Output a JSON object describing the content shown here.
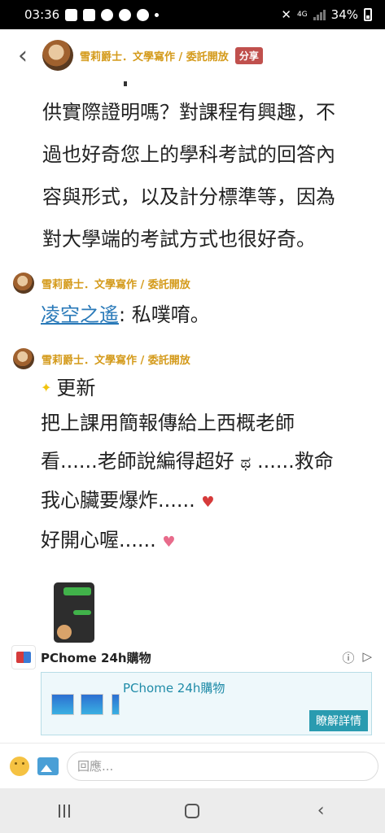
{
  "status_bar": {
    "time": "03:36",
    "network": "4G",
    "battery": "34%"
  },
  "header": {
    "back_icon": "chevron-left-icon",
    "author": "雪莉爵士．文學寫作 / 委託開放",
    "share_label": "分享"
  },
  "post": {
    "lines": [
      "供實際證明嗎？對課程有興趣，不",
      "過也好奇您上的學科考試的回答內",
      "容與形式，以及計分標準等，因為",
      "對大學端的考試方式也很好奇。"
    ]
  },
  "comments": [
    {
      "author": "雪莉爵士．文學寫作 / 委託開放",
      "mention": "凌空之遙",
      "text": ": 私噗唷。"
    },
    {
      "author": "雪莉爵士．文學寫作 / 委託開放",
      "lines": [
        "更新",
        "把上課用簡報傳給上西概老師",
        "看......老師說編得超好",
        "......救命",
        "我心臟要爆炸......",
        "好開心喔......"
      ]
    }
  ],
  "ad": {
    "title": "PChome 24h購物",
    "card_title": "PChome 24h購物",
    "more_label": "瞭解詳情"
  },
  "input_bar": {
    "placeholder": "回應..."
  },
  "colors": {
    "author_gold": "#d49a1a",
    "share_red": "#c0504d",
    "link_blue": "#2a7ab9",
    "ad_teal": "#2a9bb0"
  }
}
